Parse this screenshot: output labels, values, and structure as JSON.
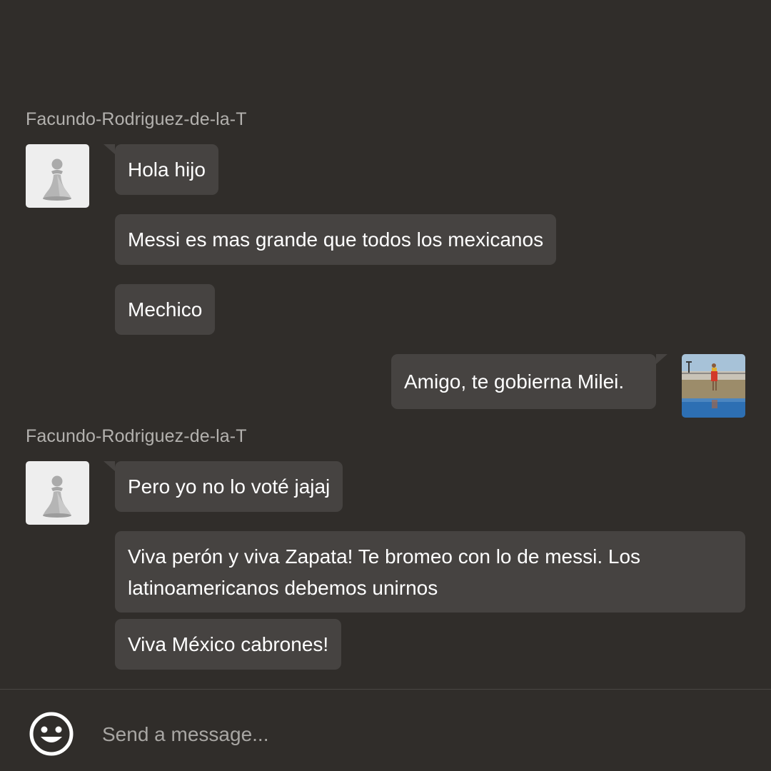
{
  "conversation": {
    "groups": [
      {
        "username": "Facundo-Rodriguez-de-la-T",
        "avatar_icon": "chess-pawn-icon",
        "messages": [
          "Hola hijo",
          "Messi es mas grande que todos los mexicanos",
          "Mechico"
        ]
      },
      {
        "sender": "self",
        "avatar_icon": "user-photo-avatar",
        "messages": [
          "Amigo, te gobierna Milei."
        ]
      },
      {
        "username": "Facundo-Rodriguez-de-la-T",
        "avatar_icon": "chess-pawn-icon",
        "messages": [
          "Pero yo no lo voté jajaj",
          "Viva perón y viva Zapata! Te bromeo con lo de messi. Los latinoamericanos debemos unirnos",
          "Viva México cabrones!"
        ]
      }
    ]
  },
  "composer": {
    "emoji_icon": "smiley-face-icon",
    "placeholder": "Send a message..."
  },
  "colors": {
    "background": "#302d2a",
    "bubble": "#464341",
    "username": "#b3b1ae",
    "text": "#ffffff",
    "placeholder": "#a8a6a3"
  }
}
